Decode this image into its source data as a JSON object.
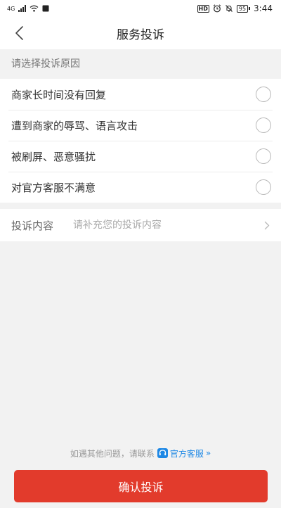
{
  "status_bar": {
    "network": "4G",
    "hd_badge": "HD",
    "battery": "95",
    "time": "3:44"
  },
  "nav": {
    "title": "服务投诉",
    "back_icon": "chevron-left-icon"
  },
  "reasons": {
    "header": "请选择投诉原因",
    "items": [
      {
        "label": "商家长时间没有回复",
        "selected": false
      },
      {
        "label": "遭到商家的辱骂、语言攻击",
        "selected": false
      },
      {
        "label": "被刷屏、恶意骚扰",
        "selected": false
      },
      {
        "label": "对官方客服不满意",
        "selected": false
      }
    ]
  },
  "complaint_content": {
    "label": "投诉内容",
    "placeholder": "请补充您的投诉内容",
    "value": ""
  },
  "footer": {
    "contact_text": "如遇其他问题，请联系",
    "service_link": "官方客服",
    "service_arrow": "»",
    "service_icon": "customer-service-icon"
  },
  "submit": {
    "label": "确认投诉",
    "color": "#e23b2c"
  },
  "colors": {
    "accent": "#e23b2c",
    "link": "#1e88e5",
    "background": "#f2f2f2"
  }
}
